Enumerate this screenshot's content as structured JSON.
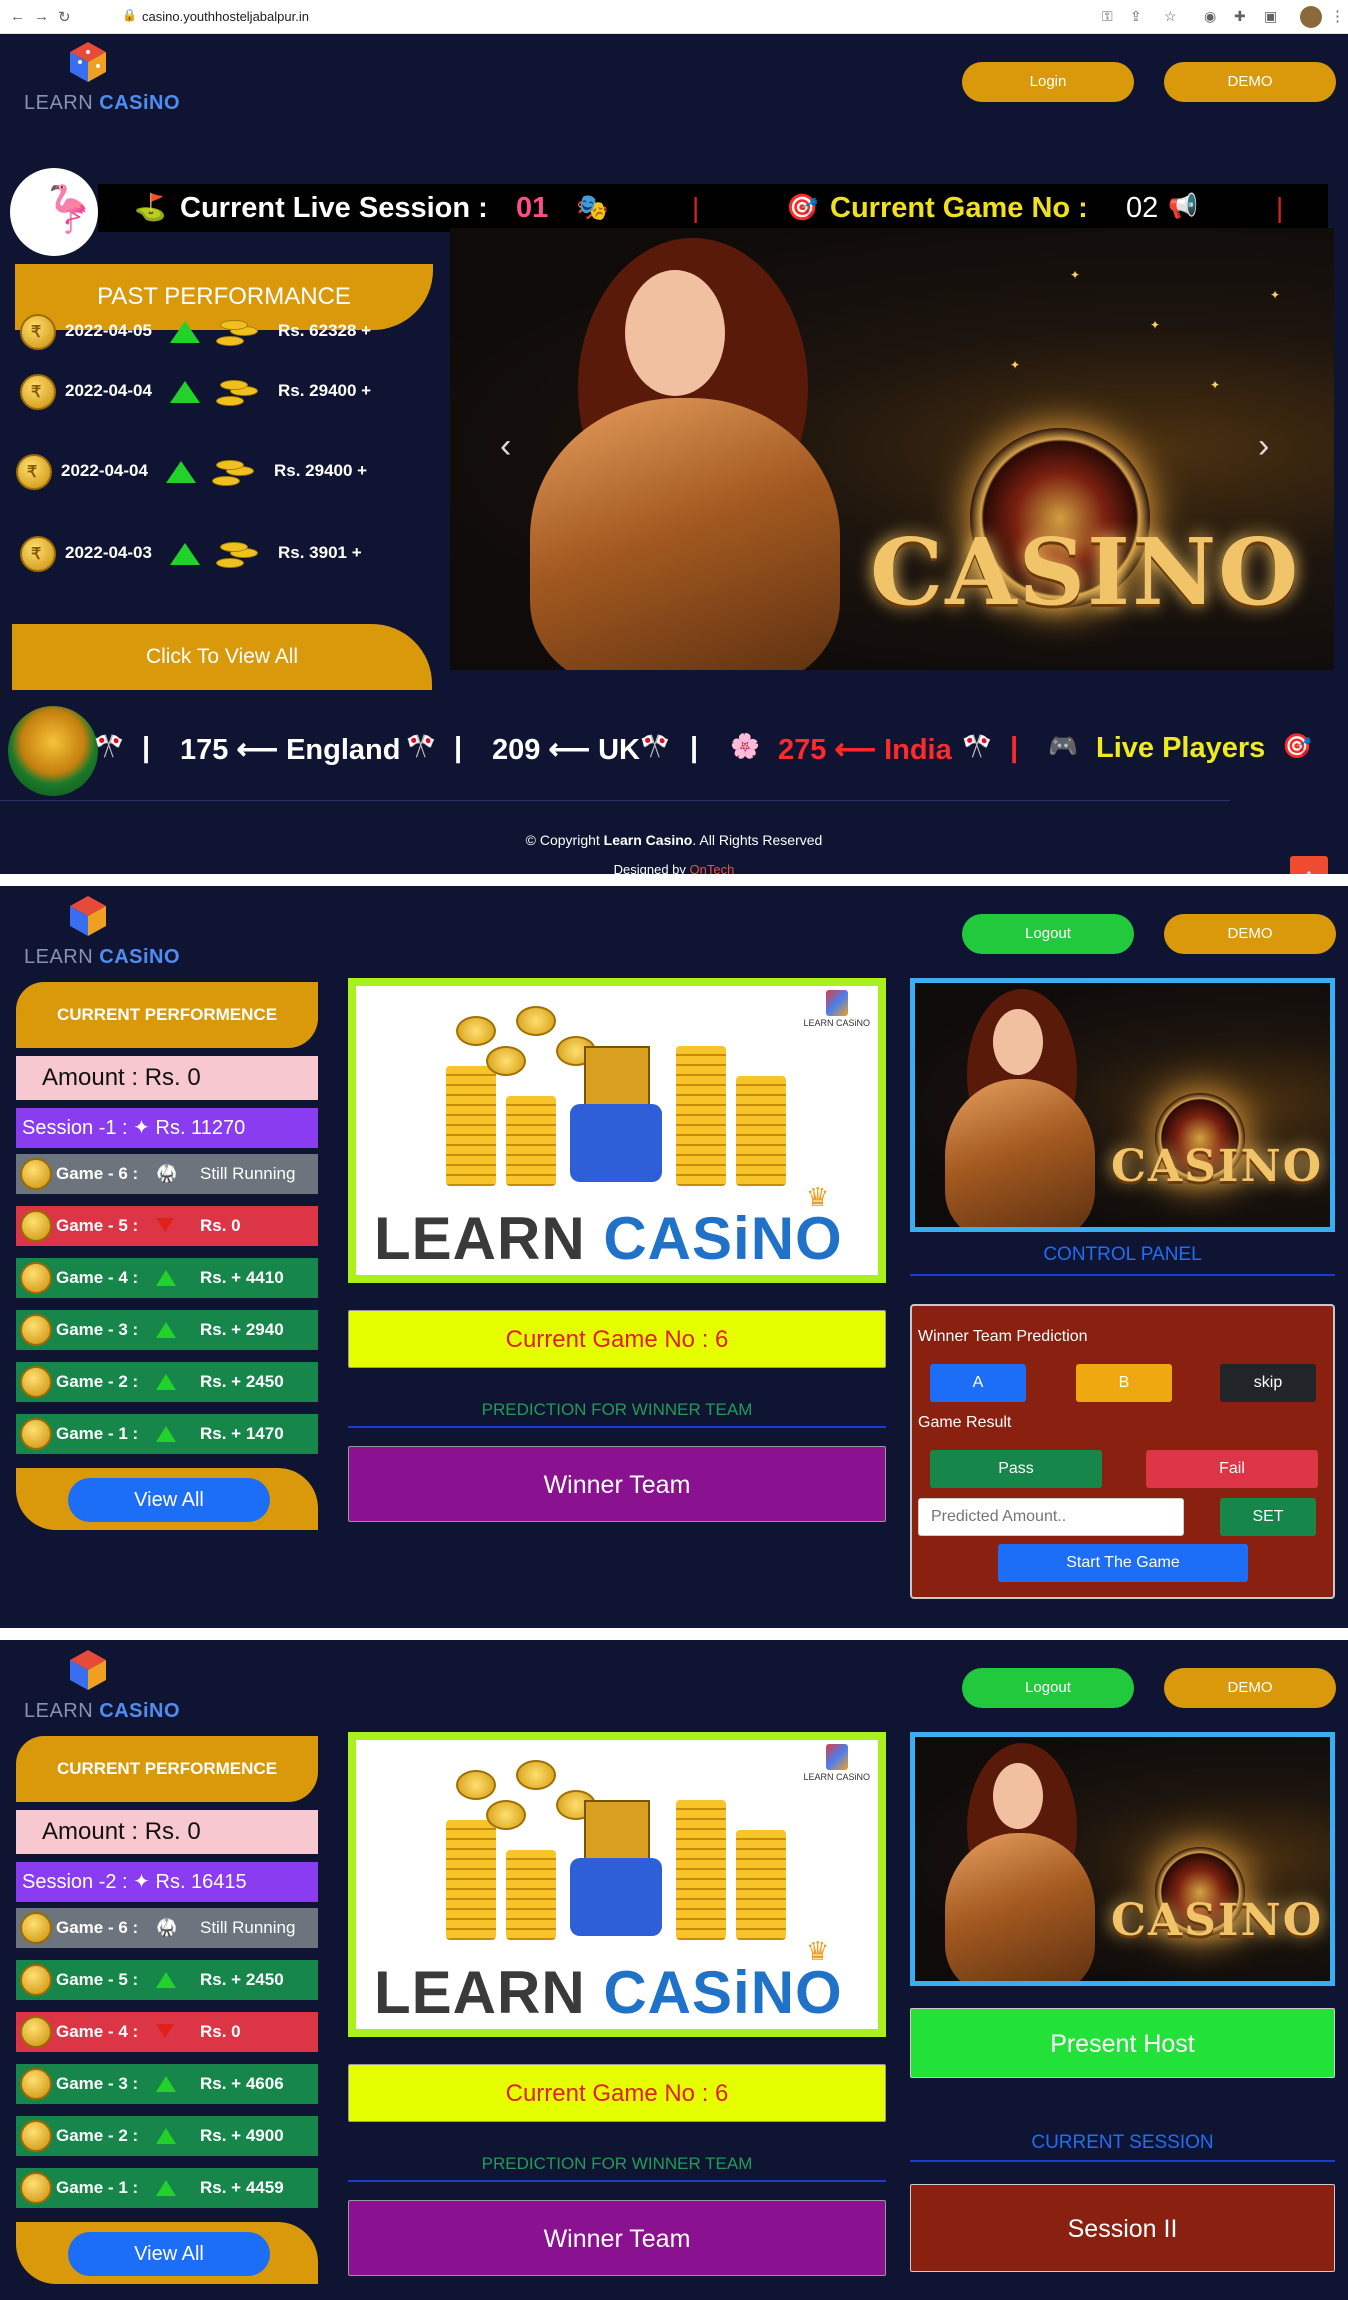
{
  "browser": {
    "url": "casino.youthhosteljabalpur.in"
  },
  "brand": {
    "learn": "LEARN",
    "casino": "CASiNO"
  },
  "panel1": {
    "login_label": "Login",
    "demo_label": "DEMO",
    "live": {
      "session_label": "Current Live Session :",
      "session_value": "01",
      "game_label": "Current Game No :",
      "game_value": "02"
    },
    "past_performance": {
      "title": "PAST PERFORMANCE",
      "rows": [
        {
          "date": "2022-04-05",
          "amount": "Rs.  62328 +"
        },
        {
          "date": "2022-04-04",
          "amount": "Rs.  29400 +"
        },
        {
          "date": "2022-04-04",
          "amount": "Rs.  29400 +"
        },
        {
          "date": "2022-04-03",
          "amount": "Rs.  3901 +"
        }
      ],
      "view_all": "Click To View All"
    },
    "hero_word": "CASINO",
    "ticker": {
      "england": "175 ⟵ England",
      "uk": "209 ⟵ UK",
      "india": "275 ⟵ India",
      "live_players": "Live Players"
    },
    "footer": {
      "copyright_pre": "© Copyright",
      "copyright_brand": "Learn Casino",
      "copyright_post": ". All Rights Reserved",
      "designed_by": "Designed by",
      "designer": "OnTech"
    }
  },
  "panel2": {
    "logout_label": "Logout",
    "demo_label": "DEMO",
    "current_performance": "CURRENT PERFORMENCE",
    "amount": "Amount : Rs. 0",
    "session": "Session -1 :",
    "session_value": "Rs. 11270",
    "games": [
      {
        "label": "Game - 6 :",
        "value": "Still Running",
        "status": "running"
      },
      {
        "label": "Game - 5 :",
        "value": "Rs. 0",
        "status": "loss"
      },
      {
        "label": "Game - 4 :",
        "value": "Rs. + 4410",
        "status": "win"
      },
      {
        "label": "Game - 3 :",
        "value": "Rs. + 2940",
        "status": "win"
      },
      {
        "label": "Game - 2 :",
        "value": "Rs. + 2450",
        "status": "win"
      },
      {
        "label": "Game - 1 :",
        "value": "Rs. + 1470",
        "status": "win"
      }
    ],
    "view_all": "View All",
    "logo_learn": "LEARN",
    "logo_casino": "CASiNO",
    "current_game": "Current Game No : 6",
    "prediction_label": "PREDICTION FOR WINNER TEAM",
    "winner_team": "Winner Team",
    "control_panel": "CONTROL PANEL",
    "control": {
      "winner_prediction": "Winner Team Prediction",
      "btn_a": "A",
      "btn_b": "B",
      "btn_skip": "skip",
      "game_result": "Game Result",
      "pass": "Pass",
      "fail": "Fail",
      "amount_placeholder": "Predicted Amount..",
      "set": "SET",
      "start": "Start The Game"
    }
  },
  "panel3": {
    "logout_label": "Logout",
    "demo_label": "DEMO",
    "current_performance": "CURRENT PERFORMENCE",
    "amount": "Amount : Rs. 0",
    "session": "Session -2 :",
    "session_value": "Rs. 16415",
    "games": [
      {
        "label": "Game - 6 :",
        "value": "Still Running",
        "status": "running"
      },
      {
        "label": "Game - 5 :",
        "value": "Rs. + 2450",
        "status": "win"
      },
      {
        "label": "Game - 4 :",
        "value": "Rs. 0",
        "status": "loss"
      },
      {
        "label": "Game - 3 :",
        "value": "Rs. + 4606",
        "status": "win"
      },
      {
        "label": "Game - 2 :",
        "value": "Rs. + 4900",
        "status": "win"
      },
      {
        "label": "Game - 1 :",
        "value": "Rs. + 4459",
        "status": "win"
      }
    ],
    "view_all": "View All",
    "logo_learn": "LEARN",
    "logo_casino": "CASiNO",
    "current_game": "Current Game No : 6",
    "prediction_label": "PREDICTION FOR WINNER TEAM",
    "winner_team": "Winner Team",
    "present_host": "Present Host",
    "current_session_label": "CURRENT SESSION",
    "current_session": "Session II"
  },
  "colors": {
    "bg": "#0f1433",
    "gold": "#d9990a",
    "win": "#16864a",
    "loss": "#dc3545",
    "running": "#6c757d",
    "session": "#8a3df0"
  }
}
